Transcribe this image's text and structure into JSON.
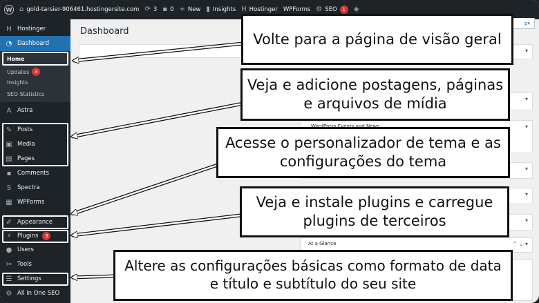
{
  "admin_bar": {
    "site_name": "gold-tarsier-906461.hostingersite.com",
    "updates_count": "3",
    "comments_count": "0",
    "new_label": "New",
    "insights_label": "Insights",
    "hostinger_label": "Hostinger",
    "wpforms_label": "WPForms",
    "seo_label": "SEO",
    "seo_badge": "1"
  },
  "sidebar": {
    "hostinger": "Hostinger",
    "dashboard": "Dashboard",
    "home": "Home",
    "updates": "Updates",
    "updates_badge": "3",
    "insights": "Insights",
    "seo_statistics": "SEO Statistics",
    "astra": "Astra",
    "posts": "Posts",
    "media": "Media",
    "pages": "Pages",
    "comments": "Comments",
    "spectra": "Spectra",
    "wpforms": "WPForms",
    "appearance": "Appearance",
    "plugins": "Plugins",
    "plugins_badge": "3",
    "users": "Users",
    "tools": "Tools",
    "settings": "Settings",
    "all_in_one_seo": "All in One SEO"
  },
  "main": {
    "title": "Dashboard",
    "screen_options": "p",
    "events_panel": "WordPress Events and News",
    "at_a_glance": "At a Glance"
  },
  "callouts": {
    "home": "Volte para a página de visão geral",
    "content": "Veja e adicione postagens, páginas e arquivos de mídia",
    "appearance": "Acesse o personalizador de tema e as configurações do tema",
    "plugins": "Veja e instale plugins e carregue plugins de terceiros",
    "settings": "Altere as configurações básicas como formato de data e título e subtítulo do seu site"
  },
  "colors": {
    "admin_bar": "#1d2327",
    "accent": "#2271b1",
    "badge": "#d63638"
  }
}
